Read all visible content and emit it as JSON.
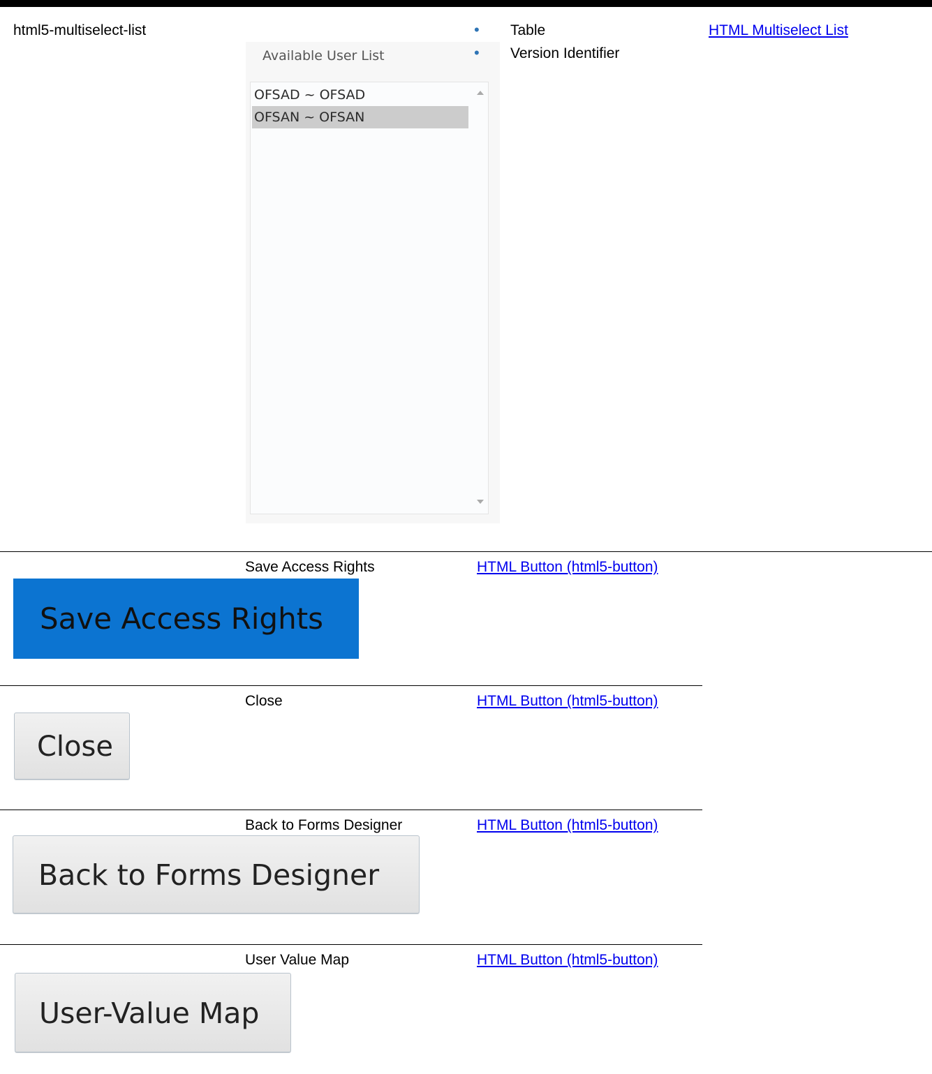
{
  "row1": {
    "component": "html5-multiselect-list",
    "picture": {
      "title": "Available User List",
      "options": [
        "OFSAD ~ OFSAD",
        "OFSAN ~ OFSAN"
      ],
      "selected_index": 1
    },
    "bullets": [
      "Table",
      "Version Identifier"
    ],
    "link": "HTML Multiselect List"
  },
  "row2": {
    "label": "Save Access Rights",
    "button_text": "Save Access Rights",
    "link": "HTML Button (html5-button)"
  },
  "row3": {
    "label": "Close",
    "button_text": "Close",
    "link": "HTML Button (html5-button)"
  },
  "row4": {
    "label": "Back to Forms Designer",
    "button_text": "Back to Forms Designer",
    "link": "HTML Button (html5-button)"
  },
  "row5": {
    "label": "User Value Map",
    "button_text": "User-Value Map",
    "link": "HTML Button (html5-button)"
  },
  "colors": {
    "accent_button": "#0c74d1",
    "link": "#0000ee",
    "bullet": "#2e74b5"
  }
}
